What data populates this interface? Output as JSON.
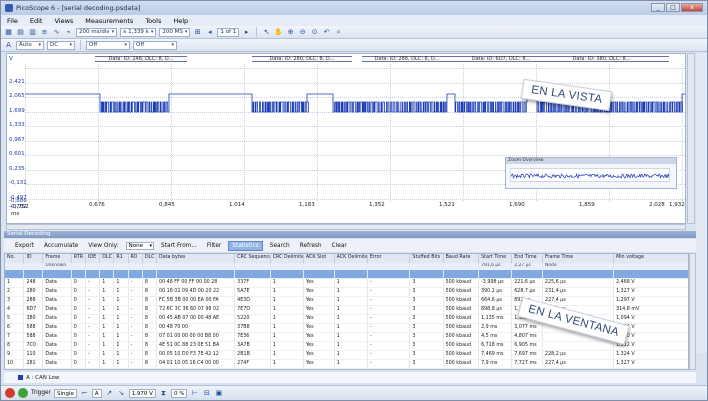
{
  "window": {
    "title": "PicoScope 6 - [serial decoding.psdata]",
    "controls": [
      "_",
      "□",
      "x"
    ]
  },
  "menu": [
    "File",
    "Edit",
    "Views",
    "Measurements",
    "Tools",
    "Help"
  ],
  "toolbar1": {
    "timebase": "200 ms/div",
    "zoom": "x 1,339 k",
    "samples": "200 MS",
    "page": "1 of 1"
  },
  "toolbar2": {
    "channel": "A",
    "mode": "Auto",
    "coupling": "DC",
    "off1": "Off",
    "off2": "Off"
  },
  "scope": {
    "packets": [
      "Data: ID: 248, DLC: 8, D...",
      "Data: ID: 280, DLC: 8, D...",
      "Data: ID: 288, DLC: 8, D...",
      "Data: ID: 6D7, DLC: 8...",
      "Data: ID: 380, DLC: 8..."
    ],
    "y_labels": [
      "V",
      "2,421",
      "2,065",
      "1,699",
      "1,333",
      "0,967",
      "0,601",
      "0,235",
      "-0,131",
      "-0,497"
    ],
    "y_bottom": [
      "-0,886",
      "-0,752"
    ],
    "x_labels": [
      "0,676",
      "0,845",
      "1,014",
      "1,183",
      "1,352",
      "1,521",
      "1,690",
      "1,859",
      "2,028"
    ],
    "x_first": "-0,752",
    "x_last": "1,932",
    "x_unit": "ms",
    "overview_title": "Zoom Overview"
  },
  "annotations": {
    "view": "EN LA VISTA",
    "window": "EN LA VENTANA"
  },
  "decoding": {
    "title": "Serial Decoding",
    "buttons": {
      "export": "Export",
      "accumulate": "Accumulate",
      "view_only": "View Only:",
      "view_value": "None",
      "start_from": "Start From...",
      "filter": "Filter",
      "statistics": "Statistics",
      "search": "Search",
      "refresh": "Refresh",
      "clear": "Clear"
    },
    "columns": [
      "No.",
      "ID",
      "Frame",
      "RTR",
      "IDE",
      "DLC",
      "R1",
      "R0",
      "DLC",
      "Data bytes",
      "CRC Sequence",
      "CRC Delimiter",
      "ACK Slot",
      "ACK Delimiter",
      "Error",
      "Stuffed Bits",
      "Baud Rate",
      "Start Time",
      "End Time",
      "Frame Time",
      "Min voltage"
    ],
    "subheader": {
      "frame": "Unknown",
      "start": "791,6 µs",
      "end": "2,27 µs",
      "frametime": "Node"
    },
    "rows": [
      [
        "1",
        "248",
        "Data",
        "0",
        "-",
        "1",
        "1",
        "-",
        "8",
        "00 48 FF 00 FF 00 00 28",
        "337F",
        "1",
        "Yes",
        "1",
        "-",
        "3",
        "500 kbaud",
        "-3,998 µs",
        "221,6 µs",
        "225,6 µs",
        "2,468 V"
      ],
      [
        "2",
        "280",
        "Data",
        "0",
        "-",
        "1",
        "1",
        "-",
        "8",
        "00 18 02 09 4D 00 20 22",
        "5A7E",
        "1",
        "Yes",
        "1",
        "-",
        "3",
        "500 kbaud",
        "390,2 µs",
        "628,7 µs",
        "231,4 µs",
        "1,327 V"
      ],
      [
        "3",
        "288",
        "Data",
        "0",
        "-",
        "1",
        "1",
        "-",
        "8",
        "FC 5B 3B 00 00 EA 00 FA",
        "4E3D",
        "1",
        "Yes",
        "1",
        "-",
        "3",
        "500 kbaud",
        "664,6 µs",
        "892 µs",
        "227,4 µs",
        "1,297 V"
      ],
      [
        "4",
        "6D7",
        "Data",
        "0",
        "-",
        "1",
        "1",
        "-",
        "8",
        "72 6C 3C 36 60 07 98 02",
        "7E7D",
        "1",
        "Yes",
        "1",
        "-",
        "3",
        "500 kbaud",
        "898,8 µs",
        "1,126 ms",
        "227,2 µs",
        "314,8 mV"
      ],
      [
        "5",
        "380",
        "Data",
        "0",
        "-",
        "1",
        "1",
        "-",
        "8",
        "00 45 AB 07 00 00 48 AE",
        "5220",
        "1",
        "Yes",
        "1",
        "-",
        "3",
        "500 kbaud",
        "1,135 ms",
        "1,362 ms",
        "",
        "1,094 V"
      ],
      [
        "6",
        "588",
        "Data",
        "0",
        "-",
        "1",
        "1",
        "-",
        "8",
        "00 48 70 00",
        "37B8",
        "1",
        "Yes",
        "1",
        "-",
        "3",
        "500 kbaud",
        "2,9 ms",
        "3,077 ms",
        "",
        "1,304 V"
      ],
      [
        "7",
        "588",
        "Data",
        "0",
        "-",
        "1",
        "1",
        "-",
        "8",
        "07 01 00 00 00 00 B8 00",
        "7E36",
        "1",
        "Yes",
        "1",
        "-",
        "3",
        "500 kbaud",
        "4,5 ms",
        "4,807 ms",
        "",
        "1,330 V"
      ],
      [
        "8",
        "7C0",
        "Data",
        "0",
        "-",
        "1",
        "1",
        "-",
        "8",
        "4E 51 0C 88 23 0E 51 BA",
        "3A7B",
        "1",
        "Yes",
        "1",
        "-",
        "3",
        "500 kbaud",
        "6,718 ms",
        "6,905 ms",
        "",
        "1,312 V"
      ],
      [
        "9",
        "110",
        "Data",
        "0",
        "-",
        "1",
        "1",
        "-",
        "8",
        "00 05 10 D0 F3 7E 42 12",
        "2B1B",
        "1",
        "Yes",
        "1",
        "-",
        "3",
        "500 kbaud",
        "7,469 ms",
        "7,697 ms",
        "228,2 µs",
        "1,324 V"
      ],
      [
        "10",
        "281",
        "Data",
        "0",
        "-",
        "1",
        "1",
        "-",
        "8",
        "04 01 10 05 16 C4 00 00",
        "274F",
        "1",
        "Yes",
        "1",
        "-",
        "3",
        "500 kbaud",
        "7,9 ms",
        "7,727 ms",
        "227,4 µs",
        "1,327 V"
      ]
    ],
    "legend": "A : CAN Low"
  },
  "status": {
    "trigger_label": "Trigger",
    "trigger_mode": "Single",
    "channel": "A",
    "level": "1,970 V",
    "pretrigger": "0 %"
  }
}
